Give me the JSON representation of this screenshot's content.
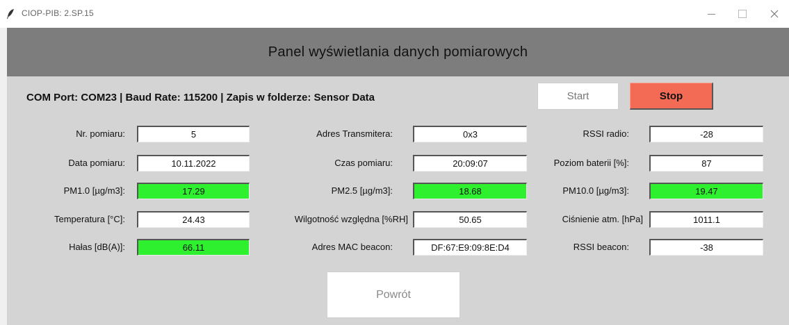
{
  "window": {
    "title": "CIOP-PIB: 2.SP.15"
  },
  "header": {
    "title": "Panel wyświetlania danych pomiarowych"
  },
  "info": {
    "line": "COM Port: COM23  |  Baud Rate: 115200  |  Zapis w folderze: Sensor Data"
  },
  "buttons": {
    "start": "Start",
    "stop": "Stop",
    "back": "Powrót"
  },
  "fields": {
    "nr_pomiaru": {
      "label": "Nr. pomiaru:",
      "value": "5"
    },
    "adres_transmitera": {
      "label": "Adres Transmitera:",
      "value": "0x3"
    },
    "rssi_radio": {
      "label": "RSSI radio:",
      "value": "-28"
    },
    "data_pomiaru": {
      "label": "Data pomiaru:",
      "value": "10.11.2022"
    },
    "czas_pomiaru": {
      "label": "Czas pomiaru:",
      "value": "20:09:07"
    },
    "poziom_baterii": {
      "label": "Poziom baterii [%]:",
      "value": "87"
    },
    "pm1": {
      "label": "PM1.0 [µg/m3]:",
      "value": "17.29"
    },
    "pm25": {
      "label": "PM2.5 [µg/m3]:",
      "value": "18.68"
    },
    "pm10": {
      "label": "PM10.0 [µg/m3]:",
      "value": "19.47"
    },
    "temperatura": {
      "label": "Temperatura [°C]:",
      "value": "24.43"
    },
    "wilgotnosc": {
      "label": "Wilgotność względna [%RH]",
      "value": "50.65"
    },
    "cisnienie": {
      "label": "Ciśnienie atm. [hPa]",
      "value": "1011.1"
    },
    "halas": {
      "label": "Hałas [dB(A)]:",
      "value": "66.11"
    },
    "mac_beacon": {
      "label": "Adres MAC beacon:",
      "value": "DF:67:E9:09:8E:D4"
    },
    "rssi_beacon": {
      "label": "RSSI beacon:",
      "value": "-38"
    }
  },
  "colors": {
    "highlight_field": "#2ef02e",
    "stop_button": "#f36b55",
    "header_bar": "#7d7d7d",
    "panel_bg": "#d4d4d4"
  },
  "icons": {
    "app": "feather-icon",
    "minimize": "minimize-icon",
    "maximize": "maximize-icon",
    "close": "close-icon"
  }
}
